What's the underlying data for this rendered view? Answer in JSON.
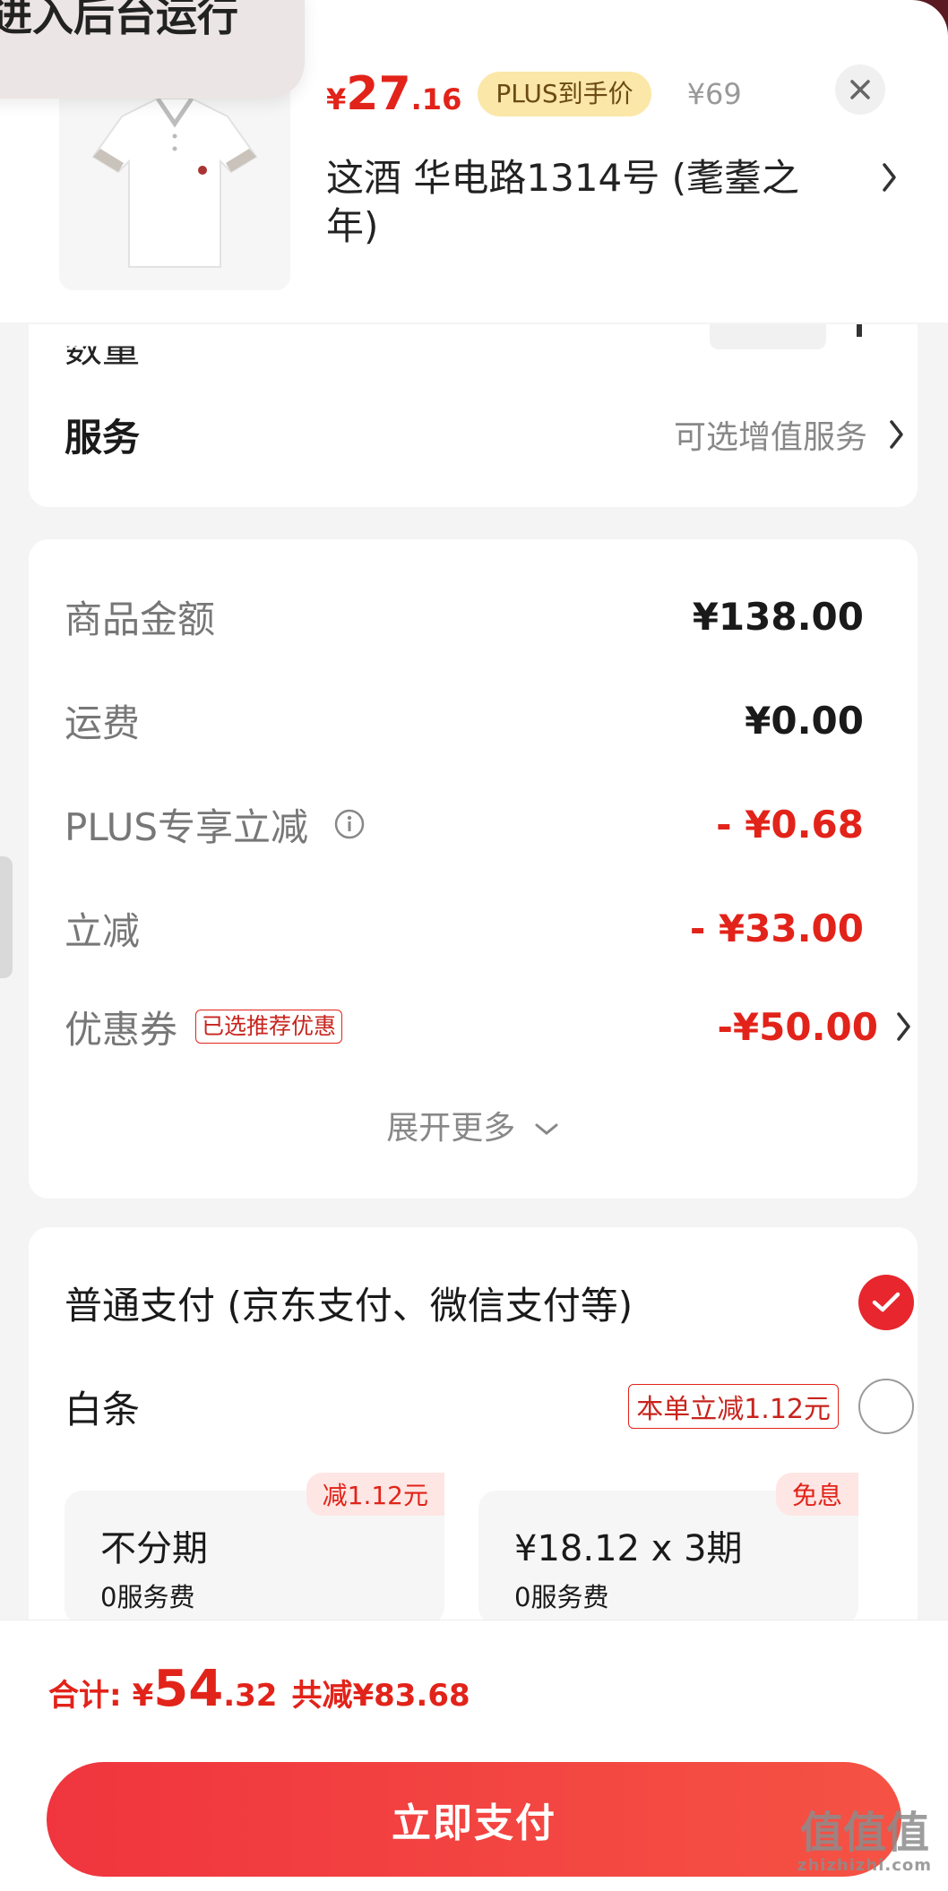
{
  "background_toast": "进入后台运行",
  "product": {
    "price_yen": "¥",
    "price_int": "27",
    "price_dec": ".16",
    "plus_badge": "PLUS到手价",
    "original_price": "¥69",
    "address": "这酒  华电路1314号 (耄耋之年)"
  },
  "order": {
    "quantity_label": "数量",
    "service_label": "服务",
    "service_value": "可选增值服务"
  },
  "fees": {
    "items": [
      {
        "label": "商品金额",
        "value": "¥138.00"
      },
      {
        "label": "运费",
        "value": "¥0.00"
      },
      {
        "label": "PLUS专享立减",
        "value": "- ¥0.68"
      },
      {
        "label": "立减",
        "value": "- ¥33.00"
      },
      {
        "label": "优惠券",
        "value": "-¥50.00",
        "tag": "已选推荐优惠"
      }
    ],
    "expand_label": "展开更多"
  },
  "payment": {
    "normal_label": "普通支付 (京东支付、微信支付等)",
    "baitiao_label": "白条",
    "baitiao_promo": "本单立减1.12元",
    "plans": [
      {
        "tag": "减1.12元",
        "title": "不分期",
        "sub": "0服务费"
      },
      {
        "tag": "免息",
        "title": "¥18.12 x 3期",
        "sub": "0服务费"
      }
    ]
  },
  "summary": {
    "total_label": "合计:",
    "total_yen": "¥",
    "total_int": "54",
    "total_dec": ".32",
    "saved": "共减¥83.68",
    "pay_button": "立即支付"
  },
  "watermark": {
    "main": "值值值",
    "sub": "zhizhizhi.com"
  },
  "colors": {
    "accent": "#e2231a",
    "plus_badge_bg": "#fbe7a8",
    "button": "#f0353e"
  }
}
